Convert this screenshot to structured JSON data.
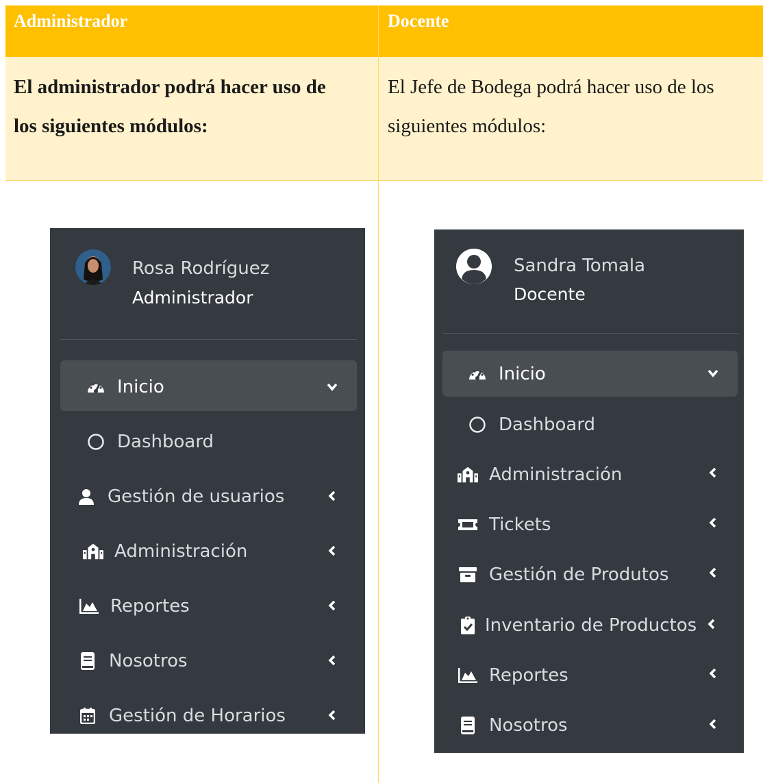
{
  "table": {
    "header": {
      "left": "Administrador",
      "right": "Docente"
    },
    "description": {
      "left_line1": "El administrador podrá hacer uso de",
      "left_line2": "los siguientes módulos:",
      "right_line1": "El Jefe de Bodega podrá hacer uso de los",
      "right_line2": "siguientes módulos:"
    }
  },
  "admin_sidebar": {
    "user_name": "Rosa Rodríguez",
    "user_role": "Administrador",
    "items": [
      {
        "label": "Inicio",
        "icon": "tachometer-icon",
        "active": true
      },
      {
        "label": "Dashboard",
        "icon": "circle-icon"
      },
      {
        "label": "Gestión de usuarios",
        "icon": "user-icon"
      },
      {
        "label": "Administración",
        "icon": "building-icon"
      },
      {
        "label": "Reportes",
        "icon": "chart-area-icon"
      },
      {
        "label": "Nosotros",
        "icon": "book-icon"
      },
      {
        "label": "Gestión de Horarios",
        "icon": "calendar-icon"
      }
    ]
  },
  "docente_sidebar": {
    "user_name": "Sandra Tomala",
    "user_role": "Docente",
    "items": [
      {
        "label": "Inicio",
        "icon": "tachometer-icon",
        "active": true
      },
      {
        "label": "Dashboard",
        "icon": "circle-icon"
      },
      {
        "label": "Administración",
        "icon": "building-icon"
      },
      {
        "label": "Tickets",
        "icon": "ticket-icon"
      },
      {
        "label": "Gestión de Produtos",
        "icon": "archive-icon"
      },
      {
        "label": "Inventario de Productos",
        "icon": "clipboard-check-icon"
      },
      {
        "label": "Reportes",
        "icon": "chart-area-icon"
      },
      {
        "label": "Nosotros",
        "icon": "book-icon"
      }
    ]
  },
  "colors": {
    "header_bg": "#ffc000",
    "description_bg": "#fff2cc",
    "sidebar_bg": "#343a40",
    "active_item_bg": "#494e53"
  }
}
